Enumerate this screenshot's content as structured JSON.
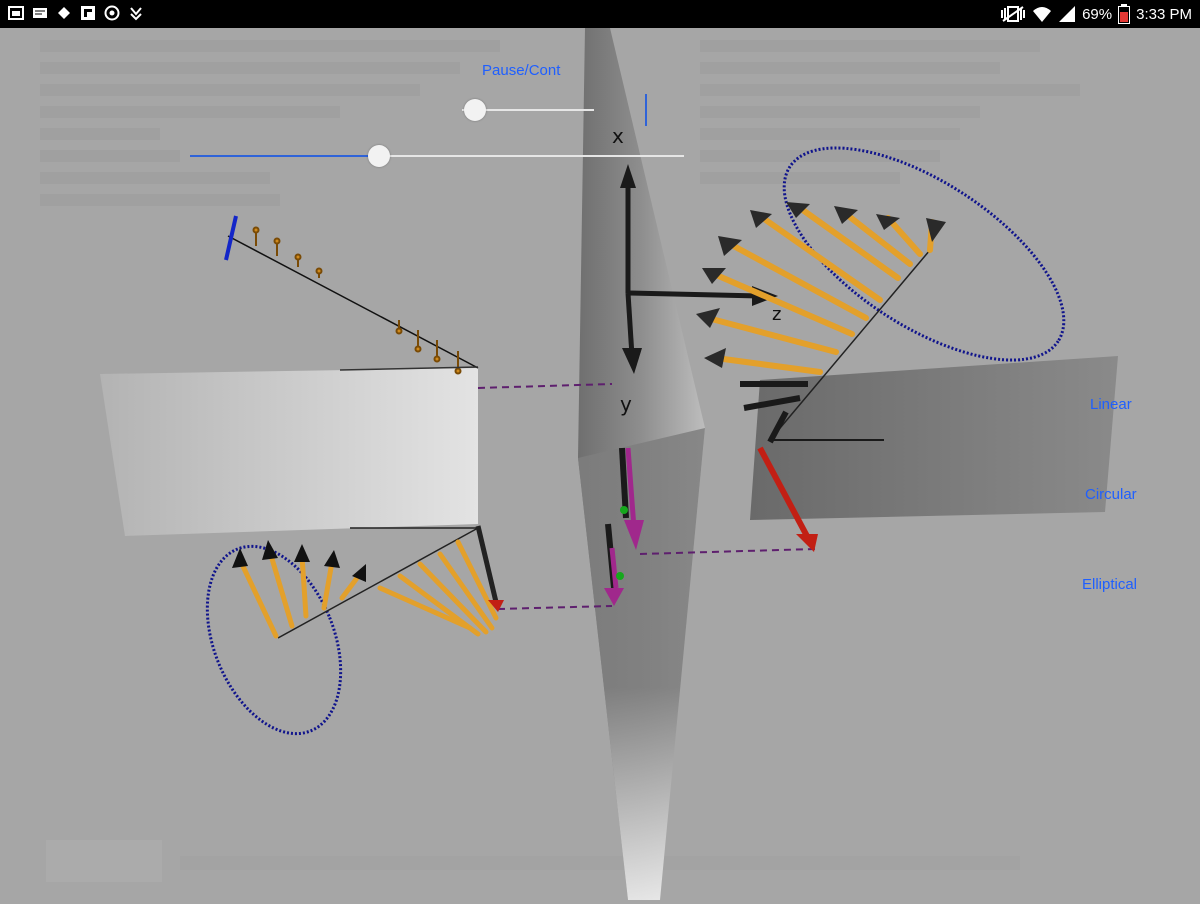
{
  "status_bar": {
    "battery": "69%",
    "time": "3:33 PM",
    "icons": [
      "gallery-icon",
      "message-icon",
      "app-icon",
      "flipboard-icon",
      "target-icon",
      "download-icon",
      "mute-vibrate-icon",
      "wifi-icon",
      "signal-icon",
      "battery-icon"
    ]
  },
  "controls": {
    "pause_label": "Pause/Cont",
    "slider1_level": 0.0,
    "slider2_level": 0.38,
    "options": [
      "Linear",
      "Circular",
      "Elliptical"
    ]
  },
  "axes": {
    "x_label": "x",
    "y_label": "y",
    "z_label": "z"
  },
  "colors": {
    "background": "#a6a6a6",
    "accent": "#1f5fff",
    "arrow_orange": "#e3a02b",
    "ellipse_blue": "#10148c",
    "dashed_purple": "#5e1f6e"
  }
}
